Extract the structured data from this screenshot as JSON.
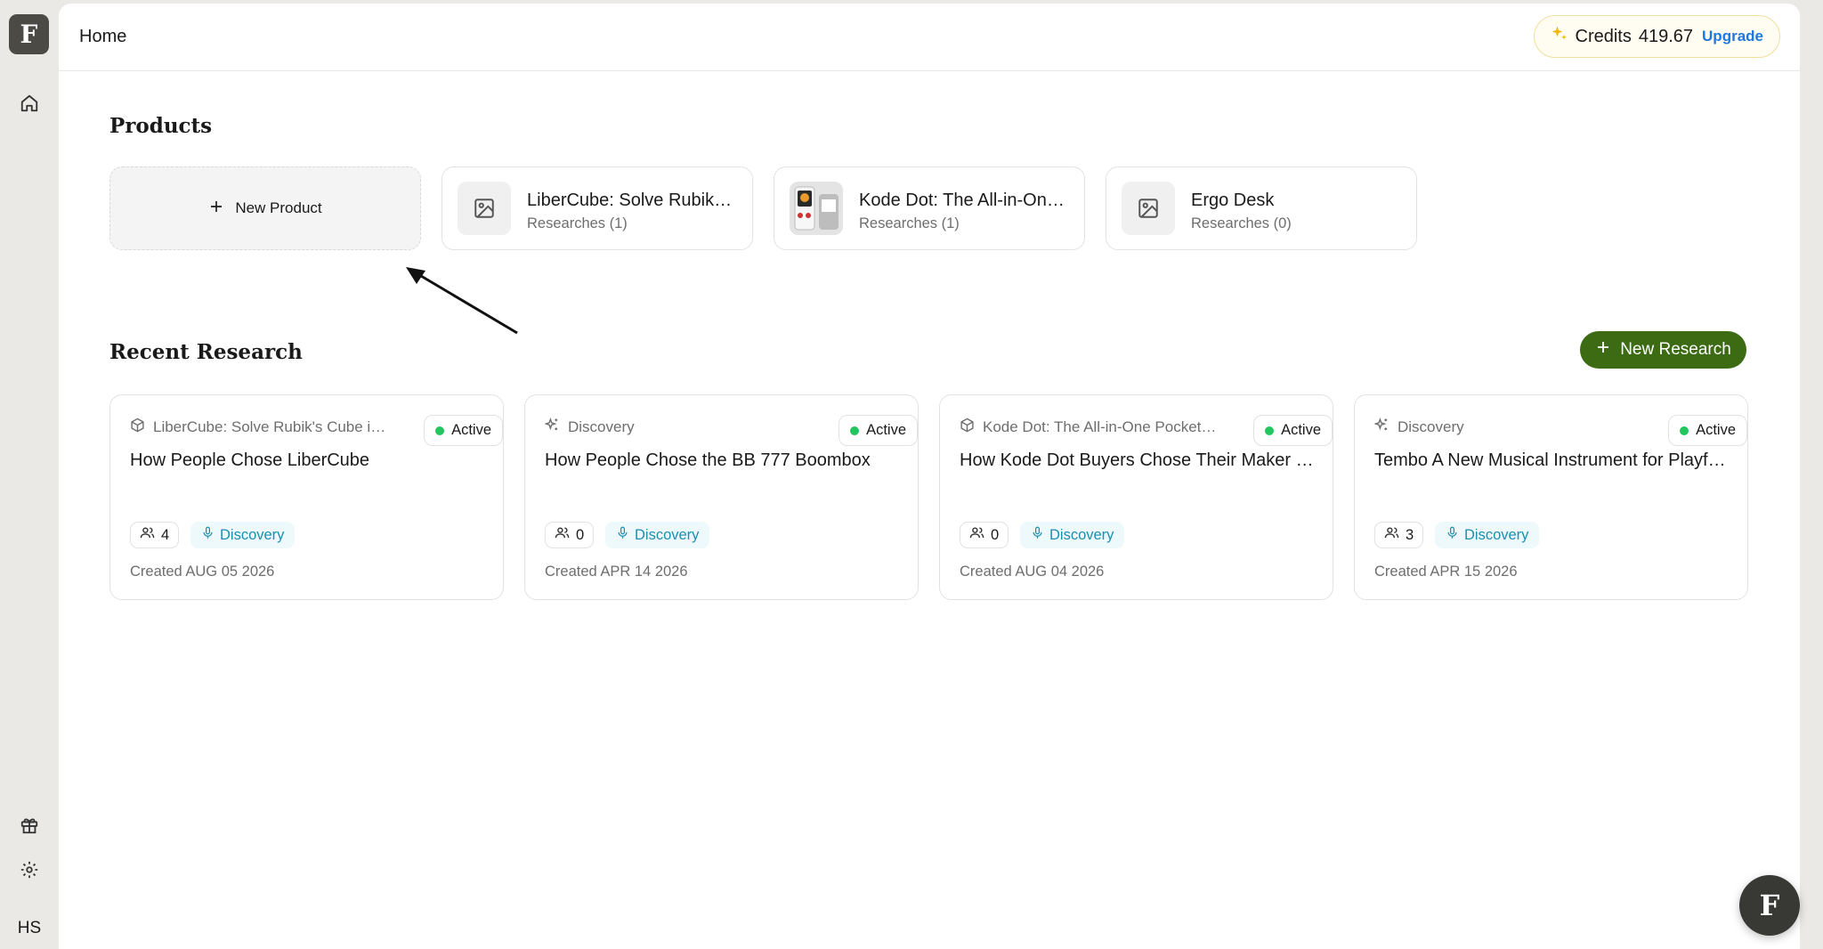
{
  "sidebar": {
    "logo_letter": "F",
    "initials": "HS",
    "icons": [
      "home-icon",
      "gift-icon",
      "settings-icon"
    ]
  },
  "header": {
    "title": "Home",
    "credits_label": "Credits",
    "credits_value": "419.67",
    "upgrade_label": "Upgrade",
    "accent_color": "#1e78e0"
  },
  "products": {
    "title": "Products",
    "new_label": "New Product",
    "items": [
      {
        "name": "LiberCube: Solve Rubik’s Cube",
        "researches": "Researches (1)",
        "thumb": "image-placeholder-icon"
      },
      {
        "name": "Kode Dot: The All-in-One Pocket",
        "researches": "Researches (1)",
        "thumb": "product-photo"
      },
      {
        "name": "Ergo Desk",
        "researches": "Researches (0)",
        "thumb": "image-placeholder-icon"
      }
    ]
  },
  "research": {
    "title": "Recent Research",
    "new_label": "New Research",
    "button_color": "#3c6b14",
    "items": [
      {
        "category": "LiberCube: Solve Rubik's Cube in Seconds",
        "category_icon": "box-icon",
        "status": "Active",
        "title": "How People Chose LiberCube",
        "count": "4",
        "tag": "Discovery",
        "created": "Created AUG 05 2026"
      },
      {
        "category": "Discovery",
        "category_icon": "sparkle-icon",
        "status": "Active",
        "title": "How People Chose the BB 777 Boombox",
        "count": "0",
        "tag": "Discovery",
        "created": "Created APR 14 2026"
      },
      {
        "category": "Kode Dot: The All-in-One Pocket Device",
        "category_icon": "box-icon",
        "status": "Active",
        "title": "How Kode Dot Buyers Chose Their Maker Device",
        "count": "0",
        "tag": "Discovery",
        "created": "Created AUG 04 2026"
      },
      {
        "category": "Discovery",
        "category_icon": "sparkle-icon",
        "status": "Active",
        "title": "Tembo A New Musical Instrument for Playful Minds",
        "count": "3",
        "tag": "Discovery",
        "created": "Created APR 15 2026"
      }
    ]
  },
  "fab": {
    "letter": "F"
  }
}
